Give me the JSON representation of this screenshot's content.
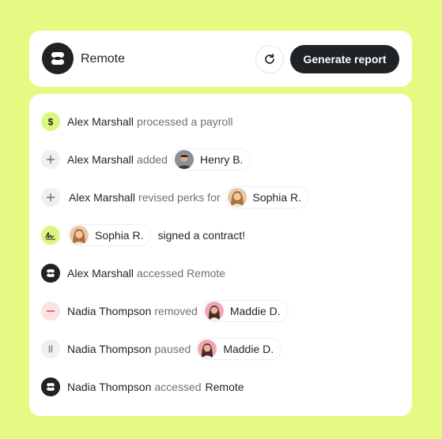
{
  "header": {
    "app_name": "Remote",
    "generate_label": "Generate report"
  },
  "colors": {
    "background": "#e4fa82",
    "dark": "#1f2326",
    "muted_text": "#6b7176",
    "accent_green": "#dcf780",
    "remove_red": "#fde3e3"
  },
  "activities": [
    {
      "icon": "dollar-icon",
      "actor": "Alex Marshall",
      "verb": "processed a payroll"
    },
    {
      "icon": "plus-icon",
      "actor": "Alex Marshall",
      "verb": "added",
      "target": "Henry B."
    },
    {
      "icon": "plus-icon",
      "actor": "Alex Marshall",
      "verb": "revised perks for",
      "target": "Sophia R."
    },
    {
      "icon": "signature-icon",
      "actor": "Sophia R.",
      "verb": "signed a contract!"
    },
    {
      "icon": "remote-logo-icon",
      "actor": "Alex Marshall",
      "verb": "accessed Remote"
    },
    {
      "icon": "minus-icon",
      "actor": "Nadia Thompson",
      "verb": "removed",
      "target": "Maddie D."
    },
    {
      "icon": "pause-icon",
      "actor": "Nadia Thompson",
      "verb": "paused",
      "target": "Maddie D."
    },
    {
      "icon": "remote-logo-icon",
      "actor": "Nadia Thompson",
      "verb": "accessed",
      "target_plain": "Remote"
    }
  ]
}
